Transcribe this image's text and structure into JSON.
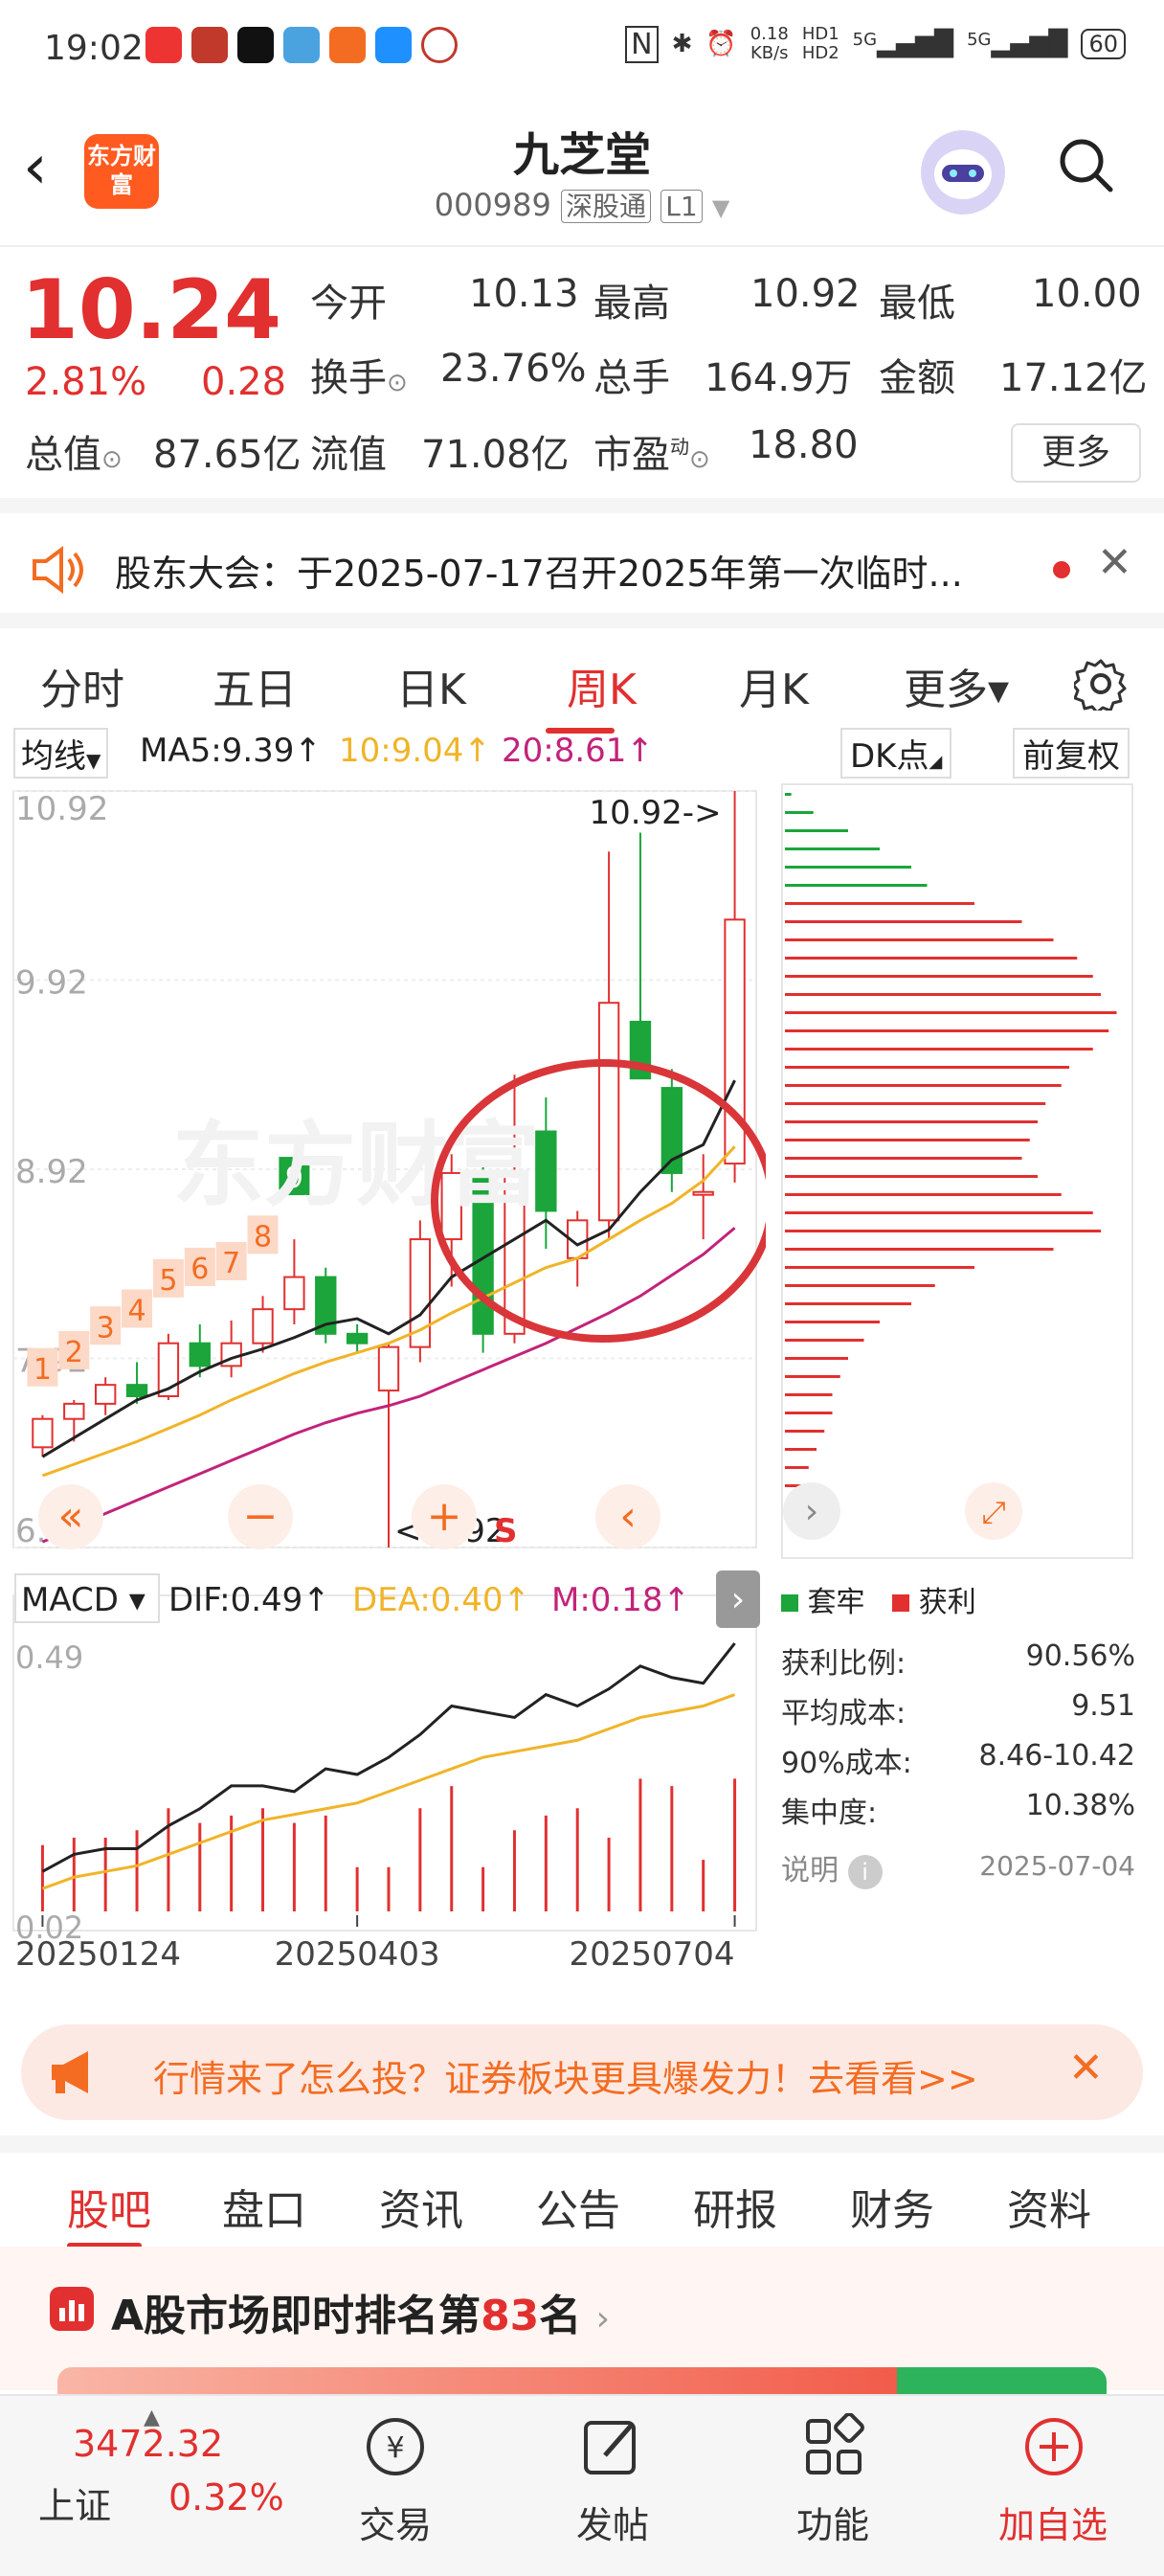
{
  "status_bar": {
    "time": "19:02",
    "net_speed_top": "0.18",
    "net_speed_unit": "KB/s",
    "hd1": "HD1",
    "hd2": "HD2",
    "sig1": "5G",
    "sig2": "5G",
    "battery": "60"
  },
  "header": {
    "logo_text": "东方财富",
    "stock_name": "九芝堂",
    "stock_code": "000989",
    "exchange_tag": "深股通",
    "level_tag": "L1"
  },
  "quote": {
    "price": "10.24",
    "change_pct": "2.81%",
    "change_abs": "0.28",
    "open_label": "今开",
    "open_value": "10.13",
    "high_label": "最高",
    "high_value": "10.92",
    "low_label": "最低",
    "low_value": "10.00",
    "turnover_label": "换手",
    "turnover_value": "23.76%",
    "volume_label": "总手",
    "volume_value": "164.9万",
    "amount_label": "金额",
    "amount_value": "17.12亿",
    "mktcap_label": "总值",
    "mktcap_value": "87.65亿",
    "float_label": "流值",
    "float_value": "71.08亿",
    "pe_label": "市盈",
    "pe_sup": "动",
    "pe_value": "18.80",
    "more_label": "更多"
  },
  "notice": {
    "text": "股东大会：于2025-07-17召开2025年第一次临时..."
  },
  "chart_tabs": [
    {
      "label": "分时"
    },
    {
      "label": "五日"
    },
    {
      "label": "日K"
    },
    {
      "label": "周K"
    },
    {
      "label": "月K"
    },
    {
      "label": "更多▾"
    }
  ],
  "ma_row": {
    "ma_select": "均线",
    "ma5": "MA5:9.39↑",
    "ma10": "10:9.04↑",
    "ma20": "20:8.61↑",
    "dk_label": "DK点",
    "fq_label": "前复权"
  },
  "kline": {
    "price_labels": [
      "10.92",
      "9.92",
      "8.92",
      "7.92",
      "6.92"
    ],
    "high_marker": "10.92->",
    "low_marker": "<-6.92",
    "s_marker": "S",
    "nine_counts": [
      "1",
      "2",
      "3",
      "4",
      "5",
      "6",
      "7",
      "8",
      "9"
    ]
  },
  "macd": {
    "select": "MACD",
    "dif": "DIF:0.49↑",
    "dea": "DEA:0.40↑",
    "m": "M:0.18↑",
    "top": "0.49",
    "bottom": "0.02"
  },
  "dates": [
    "20250124",
    "20250403",
    "20250704"
  ],
  "chip": {
    "legend_trapped": "套牢",
    "legend_profit": "获利",
    "rows": [
      {
        "label": "获利比例:",
        "value": "90.56%"
      },
      {
        "label": "平均成本:",
        "value": "9.51"
      },
      {
        "label": "90%成本:",
        "value": "8.46-10.42"
      },
      {
        "label": "集中度:",
        "value": "10.38%"
      }
    ],
    "note_label": "说明",
    "note_date": "2025-07-04"
  },
  "chart_data": {
    "type": "candlestick",
    "title": "000989 九芝堂 周K",
    "x": [
      "20250124",
      "",
      "",
      "",
      "",
      "",
      "",
      "",
      "",
      "",
      "20250403",
      "",
      "",
      "",
      "",
      "",
      "",
      "",
      "",
      "",
      "",
      "",
      "20250704",
      ""
    ],
    "ohlc": [
      [
        7.45,
        7.62,
        7.4,
        7.6
      ],
      [
        7.6,
        7.7,
        7.48,
        7.68
      ],
      [
        7.68,
        7.82,
        7.62,
        7.78
      ],
      [
        7.78,
        7.9,
        7.68,
        7.72
      ],
      [
        7.72,
        8.05,
        7.7,
        8.0
      ],
      [
        8.0,
        8.1,
        7.82,
        7.88
      ],
      [
        7.88,
        8.12,
        7.82,
        8.0
      ],
      [
        8.0,
        8.25,
        7.95,
        8.18
      ],
      [
        8.18,
        8.55,
        8.1,
        8.35
      ],
      [
        8.35,
        8.4,
        8.0,
        8.05
      ],
      [
        8.05,
        8.1,
        7.95,
        8.0
      ],
      [
        7.75,
        8.0,
        6.92,
        7.98
      ],
      [
        7.98,
        8.65,
        7.9,
        8.55
      ],
      [
        8.55,
        9.0,
        8.3,
        8.9
      ],
      [
        8.9,
        8.95,
        7.95,
        8.05
      ],
      [
        8.05,
        9.42,
        8.0,
        8.9
      ],
      [
        9.12,
        9.3,
        8.5,
        8.7
      ],
      [
        8.45,
        8.7,
        8.3,
        8.65
      ],
      [
        8.65,
        10.6,
        8.55,
        9.8
      ],
      [
        9.7,
        10.7,
        9.4,
        9.4
      ],
      [
        9.35,
        9.45,
        8.8,
        8.9
      ],
      [
        8.8,
        9.0,
        8.55,
        8.8
      ],
      [
        8.95,
        10.92,
        8.85,
        10.24
      ]
    ],
    "ma5": [
      7.4,
      7.5,
      7.6,
      7.7,
      7.76,
      7.85,
      7.92,
      7.97,
      8.03,
      8.1,
      8.13,
      8.05,
      8.15,
      8.35,
      8.45,
      8.55,
      8.65,
      8.52,
      8.6,
      8.8,
      8.97,
      9.05,
      9.39
    ],
    "ma10": [
      7.3,
      7.36,
      7.42,
      7.48,
      7.55,
      7.62,
      7.7,
      7.77,
      7.84,
      7.9,
      7.95,
      8.0,
      8.07,
      8.16,
      8.24,
      8.32,
      8.4,
      8.45,
      8.55,
      8.65,
      8.74,
      8.86,
      9.04
    ],
    "ma20": [
      6.95,
      7.02,
      7.1,
      7.17,
      7.24,
      7.31,
      7.38,
      7.45,
      7.52,
      7.58,
      7.63,
      7.67,
      7.72,
      7.79,
      7.86,
      7.93,
      8.0,
      8.08,
      8.16,
      8.25,
      8.36,
      8.47,
      8.61
    ],
    "ylim": [
      6.92,
      10.92
    ],
    "macd": {
      "dif": [
        0.09,
        0.12,
        0.13,
        0.13,
        0.17,
        0.2,
        0.24,
        0.24,
        0.23,
        0.27,
        0.26,
        0.29,
        0.33,
        0.38,
        0.37,
        0.36,
        0.4,
        0.38,
        0.41,
        0.45,
        0.43,
        0.42,
        0.49
      ],
      "dea": [
        0.06,
        0.08,
        0.09,
        0.1,
        0.12,
        0.14,
        0.16,
        0.18,
        0.19,
        0.2,
        0.21,
        0.23,
        0.25,
        0.27,
        0.29,
        0.3,
        0.31,
        0.32,
        0.34,
        0.36,
        0.37,
        0.38,
        0.4
      ],
      "m": [
        0.09,
        0.1,
        0.1,
        0.11,
        0.14,
        0.12,
        0.13,
        0.14,
        0.12,
        0.13,
        0.06,
        0.06,
        0.14,
        0.17,
        0.06,
        0.11,
        0.13,
        0.14,
        0.1,
        0.18,
        0.17,
        0.07,
        0.18
      ],
      "ylim": [
        0.02,
        0.49
      ]
    },
    "chip_distribution": {
      "trapped": [
        4,
        18,
        40,
        60,
        80,
        90
      ],
      "profit": [
        120,
        150,
        170,
        185,
        195,
        200,
        210,
        205,
        195,
        180,
        175,
        165,
        160,
        155,
        150,
        160,
        175,
        195,
        200,
        170,
        120,
        95,
        80,
        60,
        50,
        40,
        35,
        30,
        30,
        25,
        20,
        15,
        12,
        8
      ],
      "ylim": [
        6.92,
        10.92
      ]
    }
  },
  "banner": {
    "text": "行情来了怎么投？证券板块更具爆发力！去看看>>"
  },
  "bottom_tabs": [
    {
      "label": "股吧"
    },
    {
      "label": "盘口"
    },
    {
      "label": "资讯"
    },
    {
      "label": "公告"
    },
    {
      "label": "研报"
    },
    {
      "label": "财务"
    },
    {
      "label": "资料"
    }
  ],
  "rank": {
    "prefix": "A股市场即时排名第",
    "num": "83",
    "suffix": "名"
  },
  "bottom_nav": {
    "index_value": "3472.32",
    "index_name": "上证",
    "index_pct": "0.32%",
    "trade": "交易",
    "post": "发帖",
    "func": "功能",
    "add": "加自选"
  },
  "colors": {
    "up": "#e1302f",
    "down": "#1ba53b",
    "ma5": "#222222",
    "ma10": "#f0b428",
    "ma20": "#c2237a"
  }
}
